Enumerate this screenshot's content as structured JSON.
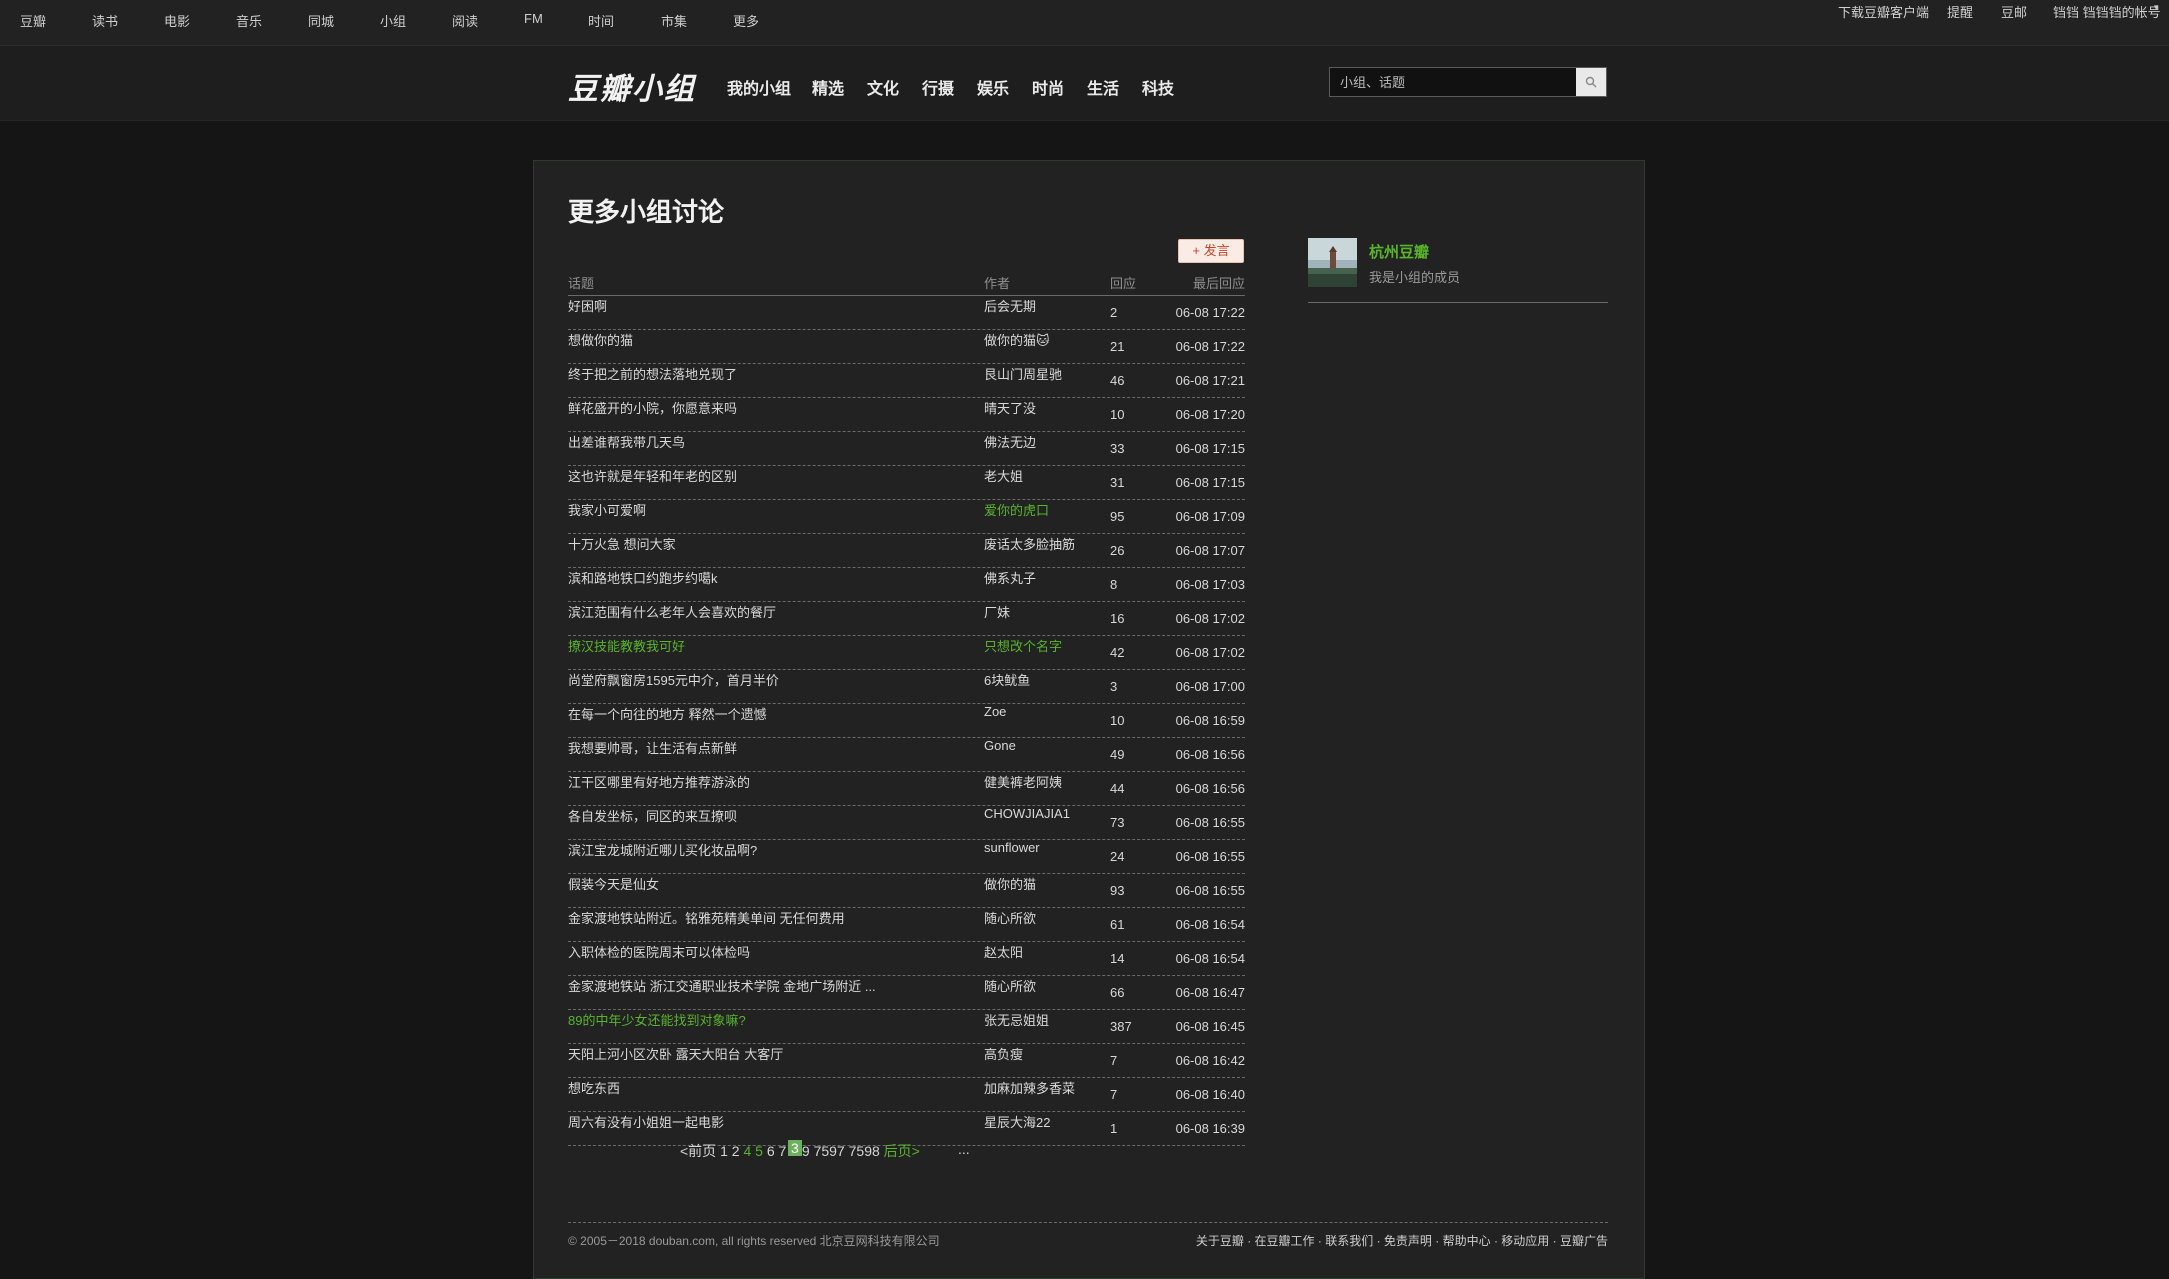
{
  "global_nav": {
    "items": [
      "豆瓣",
      "读书",
      "电影",
      "音乐",
      "同城",
      "小组",
      "阅读",
      "FM",
      "时间",
      "市集",
      "更多"
    ],
    "right": [
      "下载豆瓣客户端",
      "提醒",
      "豆邮",
      "铛铛 铛铛铛的帐号"
    ]
  },
  "header": {
    "logo": "豆瓣小组",
    "nav": [
      "我的小组",
      "精选",
      "文化",
      "行摄",
      "娱乐",
      "时尚",
      "生活",
      "科技"
    ],
    "search_placeholder": "小组、话题"
  },
  "main": {
    "title": "更多小组讨论",
    "post_button": "+ 发言",
    "columns": {
      "title": "话题",
      "author": "作者",
      "reply": "回应",
      "last": "最后回应"
    },
    "topics": [
      {
        "title": "好困啊",
        "author": "后会无期",
        "replies": "2",
        "time": "06-08 17:22",
        "title_green": false,
        "author_green": false
      },
      {
        "title": "想做你的猫",
        "author": "做你的猫🐱",
        "replies": "21",
        "time": "06-08 17:22",
        "title_green": false,
        "author_green": false
      },
      {
        "title": "终于把之前的想法落地兑现了",
        "author": "艮山门周星驰",
        "replies": "46",
        "time": "06-08 17:21",
        "title_green": false,
        "author_green": false
      },
      {
        "title": "鲜花盛开的小院，你愿意来吗",
        "author": "晴天了没",
        "replies": "10",
        "time": "06-08 17:20",
        "title_green": false,
        "author_green": false
      },
      {
        "title": "出差谁帮我带几天鸟",
        "author": "佛法无边",
        "replies": "33",
        "time": "06-08 17:15",
        "title_green": false,
        "author_green": false
      },
      {
        "title": "这也许就是年轻和年老的区别",
        "author": "老大姐",
        "replies": "31",
        "time": "06-08 17:15",
        "title_green": false,
        "author_green": false
      },
      {
        "title": "我家小可爱啊",
        "author": "爱你的虎口",
        "replies": "95",
        "time": "06-08 17:09",
        "title_green": false,
        "author_green": true
      },
      {
        "title": "十万火急 想问大家",
        "author": "废话太多脸抽筋",
        "replies": "26",
        "time": "06-08 17:07",
        "title_green": false,
        "author_green": false
      },
      {
        "title": "滨和路地铁口约跑步约噶k",
        "author": "佛系丸子",
        "replies": "8",
        "time": "06-08 17:03",
        "title_green": false,
        "author_green": false
      },
      {
        "title": "滨江范围有什么老年人会喜欢的餐厅",
        "author": "厂妹",
        "replies": "16",
        "time": "06-08 17:02",
        "title_green": false,
        "author_green": false
      },
      {
        "title": "撩汉技能教教我可好",
        "author": "只想改个名字",
        "replies": "42",
        "time": "06-08 17:02",
        "title_green": true,
        "author_green": true
      },
      {
        "title": "尚堂府飘窗房1595元中介，首月半价",
        "author": "6块鱿鱼",
        "replies": "3",
        "time": "06-08 17:00",
        "title_green": false,
        "author_green": false
      },
      {
        "title": "在每一个向往的地方 释然一个遗憾",
        "author": "Zoe",
        "replies": "10",
        "time": "06-08 16:59",
        "title_green": false,
        "author_green": false
      },
      {
        "title": "我想要帅哥，让生活有点新鲜",
        "author": "Gone",
        "replies": "49",
        "time": "06-08 16:56",
        "title_green": false,
        "author_green": false
      },
      {
        "title": "江干区哪里有好地方推荐游泳的",
        "author": "健美裤老阿姨",
        "replies": "44",
        "time": "06-08 16:56",
        "title_green": false,
        "author_green": false
      },
      {
        "title": "各自发坐标，同区的来互撩呗",
        "author": "CHOWJIAJIA1",
        "replies": "73",
        "time": "06-08 16:55",
        "title_green": false,
        "author_green": false
      },
      {
        "title": "滨江宝龙城附近哪儿买化妆品啊?",
        "author": "sunflower",
        "replies": "24",
        "time": "06-08 16:55",
        "title_green": false,
        "author_green": false
      },
      {
        "title": "假装今天是仙女",
        "author": "做你的猫",
        "replies": "93",
        "time": "06-08 16:55",
        "title_green": false,
        "author_green": false
      },
      {
        "title": "金家渡地铁站附近。铭雅苑精美单间 无任何费用",
        "author": "随心所欲",
        "replies": "61",
        "time": "06-08 16:54",
        "title_green": false,
        "author_green": false
      },
      {
        "title": "入职体检的医院周末可以体检吗",
        "author": "赵太阳",
        "replies": "14",
        "time": "06-08 16:54",
        "title_green": false,
        "author_green": false
      },
      {
        "title": "金家渡地铁站 浙江交通职业技术学院 金地广场附近 ...",
        "author": "随心所欲",
        "replies": "66",
        "time": "06-08 16:47",
        "title_green": false,
        "author_green": false
      },
      {
        "title": "89的中年少女还能找到对象嘛?",
        "author": "张无忌姐姐",
        "replies": "387",
        "time": "06-08 16:45",
        "title_green": true,
        "author_green": false
      },
      {
        "title": "天阳上河小区次卧 露天大阳台 大客厅",
        "author": "高负瘦",
        "replies": "7",
        "time": "06-08 16:42",
        "title_green": false,
        "author_green": false
      },
      {
        "title": "想吃东西",
        "author": "加麻加辣多香菜",
        "replies": "7",
        "time": "06-08 16:40",
        "title_green": false,
        "author_green": false
      },
      {
        "title": "周六有没有小姐姐一起电影",
        "author": "星辰大海22",
        "replies": "1",
        "time": "06-08 16:39",
        "title_green": false,
        "author_green": false
      }
    ],
    "pagination": {
      "prev": "<前页",
      "pages": [
        "1",
        "2",
        "3",
        "4",
        "5",
        "6",
        "7",
        "8",
        "9",
        "...",
        "7597",
        "7598"
      ],
      "current": "3",
      "next": "后页>"
    }
  },
  "sidebar": {
    "group_name": "杭州豆瓣",
    "group_status": "我是小组的成员"
  },
  "footer": {
    "copyright": "© 2005－2018 douban.com, all rights reserved 北京豆网科技有限公司",
    "links": [
      "关于豆瓣",
      "在豆瓣工作",
      "联系我们",
      "免责声明",
      "帮助中心",
      "移动应用",
      "豆瓣广告"
    ]
  },
  "colors": {
    "accent_green": "#58b52a",
    "background": "#151515",
    "panel": "#222222"
  }
}
